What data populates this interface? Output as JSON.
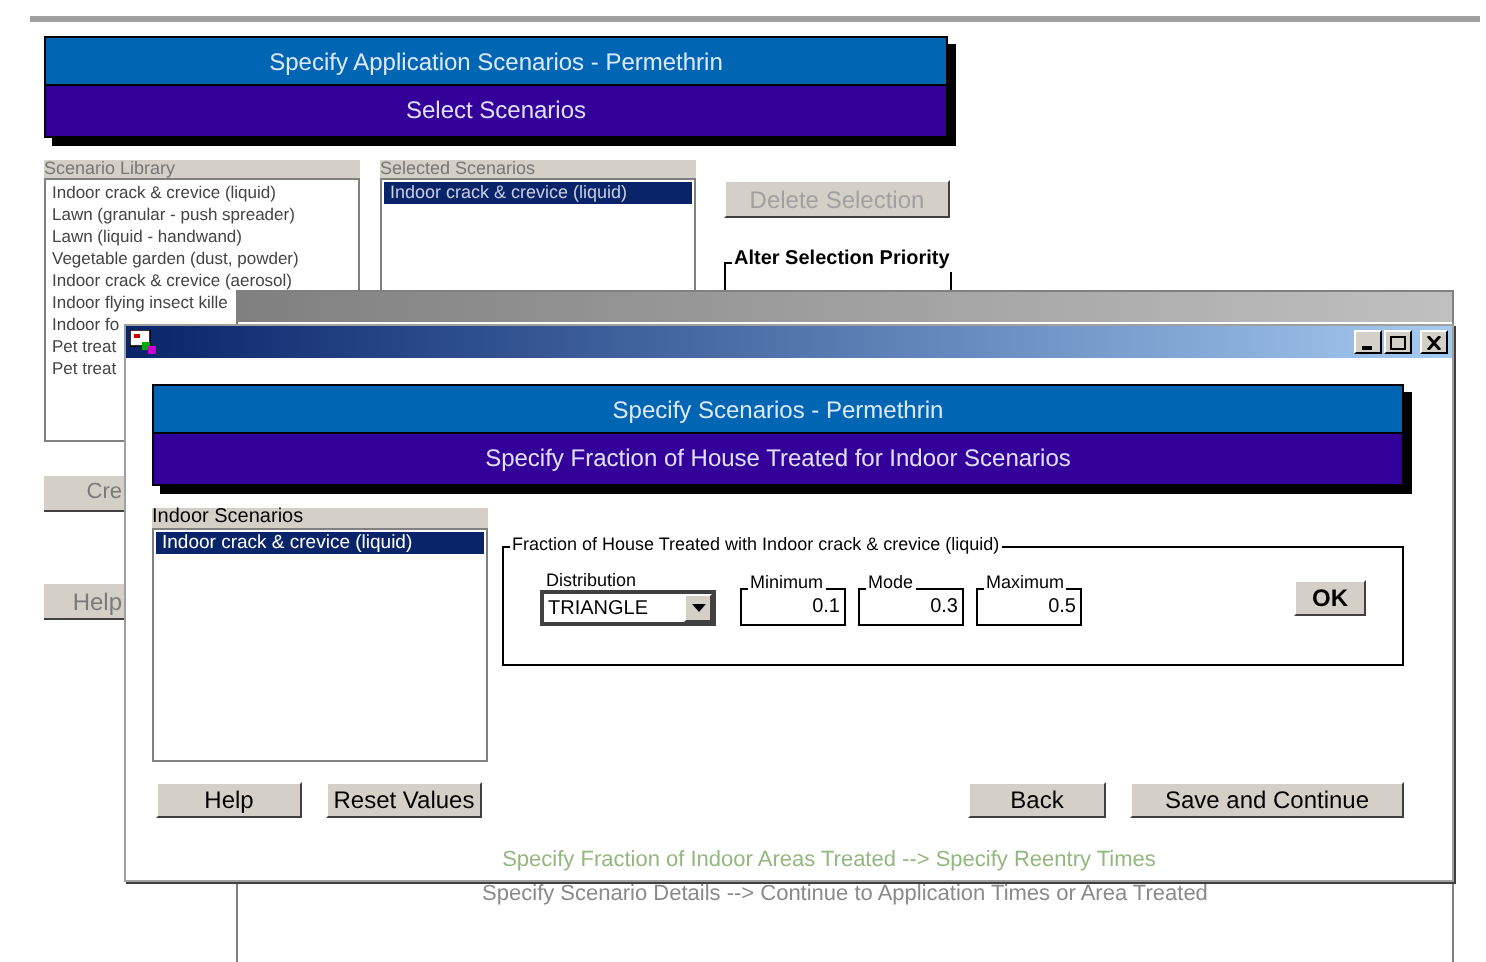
{
  "page": {
    "title": "Specify Application Scenarios - Permethrin",
    "subtitle": "Select Scenarios",
    "library": {
      "label": "Scenario Library",
      "items": [
        {
          "text": "Indoor crack & crevice (liquid)"
        },
        {
          "text": "Lawn  (granular - push spreader)"
        },
        {
          "text": "Lawn (liquid - handwand)"
        },
        {
          "text": "Vegetable garden  (dust, powder)"
        },
        {
          "text": "Indoor crack & crevice (aerosol)"
        },
        {
          "text": "Indoor flying insect kille"
        },
        {
          "text": "Indoor fo"
        },
        {
          "text": "Pet treat"
        },
        {
          "text": "Pet treat"
        }
      ]
    },
    "selected_list": {
      "label": "Selected Scenarios",
      "items": [
        {
          "text": "Indoor crack & crevice (liquid)",
          "selected": true
        }
      ]
    },
    "delete_button": {
      "label": "Delete Selection",
      "disabled": true
    },
    "priority_group": {
      "label": "Alter Selection Priority"
    },
    "buttons": [
      "Cre",
      "Help"
    ]
  },
  "middle_window": {
    "footer": "Specify Scenario Details --> Continue to Application Times or Area Treated"
  },
  "dialog": {
    "title": "Specify Scenarios - Permethrin",
    "subtitle": "Specify Fraction of House Treated for Indoor Scenarios",
    "list": {
      "label": "Indoor Scenarios",
      "items": [
        {
          "text": "Indoor crack & crevice (liquid)",
          "selected": true
        }
      ]
    },
    "group": {
      "label": "Fraction of House Treated with Indoor crack & crevice (liquid)",
      "fields": [
        {
          "kind": "select",
          "label": "Distribution",
          "value": "TRIANGLE"
        },
        {
          "kind": "number",
          "label": "Minimum",
          "value": "0.1"
        },
        {
          "kind": "number",
          "label": "Mode",
          "value": "0.3"
        },
        {
          "kind": "number",
          "label": "Maximum",
          "value": "0.5"
        }
      ],
      "ok": "OK"
    },
    "left_buttons": [
      "Help",
      "Reset Values"
    ],
    "right_buttons": [
      "Back",
      "Save and Continue"
    ],
    "footer": "Specify Fraction of Indoor Areas Treated --> Specify Reentry Times"
  }
}
